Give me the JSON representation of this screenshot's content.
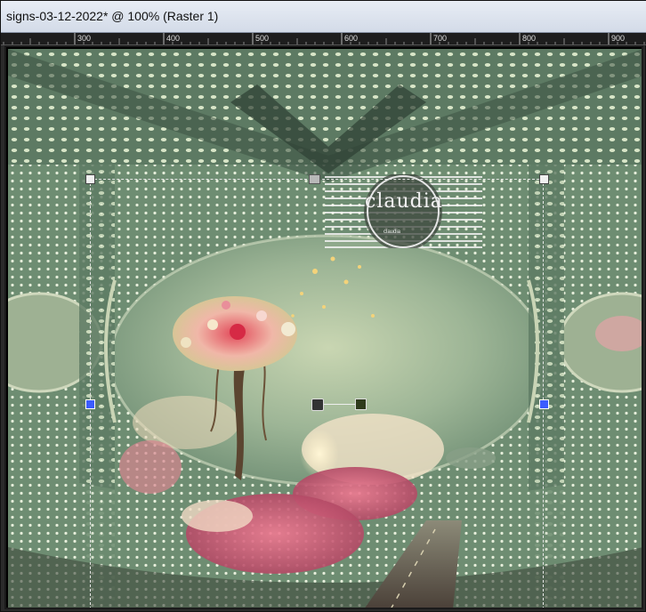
{
  "window": {
    "title": "signs-03-12-2022* @ 100% (Raster 1)"
  },
  "ruler": {
    "ticks": [
      "300",
      "400",
      "500",
      "600",
      "700",
      "800",
      "900"
    ]
  },
  "watermark": {
    "text": "claudia",
    "subtext": "claudia"
  },
  "colors": {
    "selection_handle": "#f0f0f0",
    "selection_handle_active": "#3c5cff",
    "titlebar": "#dfe5ef"
  }
}
